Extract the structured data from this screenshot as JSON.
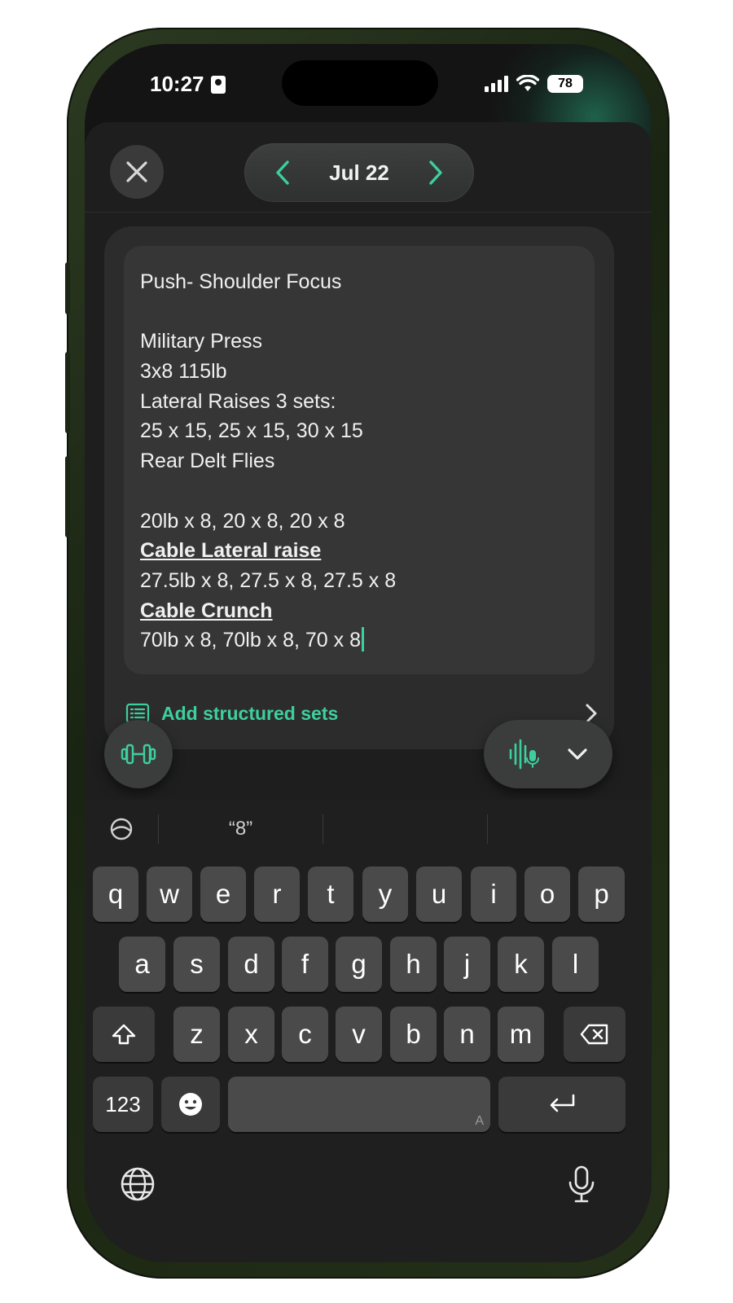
{
  "status_bar": {
    "time": "10:27",
    "battery": "78"
  },
  "header": {
    "date": "Jul 22"
  },
  "note": {
    "lines": [
      {
        "text": "Push- Shoulder Focus",
        "style": "normal"
      },
      {
        "text": "",
        "style": "normal"
      },
      {
        "text": "Military Press",
        "style": "normal"
      },
      {
        "text": "3x8 115lb",
        "style": "normal"
      },
      {
        "text": "Lateral Raises 3 sets:",
        "style": "normal"
      },
      {
        "text": "25 x 15, 25 x 15, 30 x 15",
        "style": "normal"
      },
      {
        "text": "Rear Delt Flies",
        "style": "normal"
      },
      {
        "text": "",
        "style": "normal"
      },
      {
        "text": "20lb x 8, 20 x 8, 20 x 8",
        "style": "normal"
      },
      {
        "text": "Cable Lateral raise",
        "style": "header"
      },
      {
        "text": "27.5lb x 8, 27.5 x 8, 27.5 x 8",
        "style": "normal"
      },
      {
        "text": "Cable Crunch",
        "style": "header"
      },
      {
        "text": "70lb x 8, 70lb x 8, 70 x 8",
        "style": "normal"
      }
    ]
  },
  "add_sets": {
    "label": "Add structured sets"
  },
  "keyboard": {
    "suggestions": [
      "“8”",
      "",
      ""
    ],
    "row1": [
      "q",
      "w",
      "e",
      "r",
      "t",
      "y",
      "u",
      "i",
      "o",
      "p"
    ],
    "row2": [
      "a",
      "s",
      "d",
      "f",
      "g",
      "h",
      "j",
      "k",
      "l"
    ],
    "row3": [
      "z",
      "x",
      "c",
      "v",
      "b",
      "n",
      "m"
    ],
    "numbers_key": "123",
    "space_hint": "A"
  },
  "icons": {
    "close": "close-icon",
    "prev": "chevron-left-icon",
    "next": "chevron-right-icon",
    "list": "list-icon",
    "dumbbell": "dumbbell-icon",
    "voice": "voice-waveform-mic-icon",
    "collapse": "chevron-down-icon",
    "globe": "globe-icon",
    "mic": "microphone-icon",
    "emoji": "emoji-icon",
    "shift": "shift-icon",
    "delete": "delete-icon",
    "return": "return-icon",
    "prediction": "prediction-icon"
  },
  "colors": {
    "accent": "#3ecf9e",
    "background": "#141414",
    "key": "#4a4a4a"
  }
}
